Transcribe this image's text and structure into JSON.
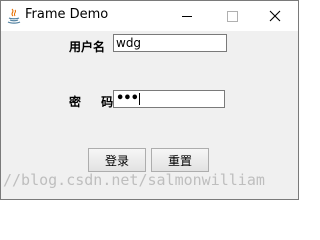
{
  "window": {
    "title": "Frame Demo",
    "icon": "java-icon"
  },
  "form": {
    "username_label": "用户名",
    "username_value": "wdg",
    "password_label": "密 码",
    "password_value": "•••"
  },
  "buttons": {
    "login": "登录",
    "reset": "重置"
  },
  "watermark": "//blog.csdn.net/salmonwilliam"
}
